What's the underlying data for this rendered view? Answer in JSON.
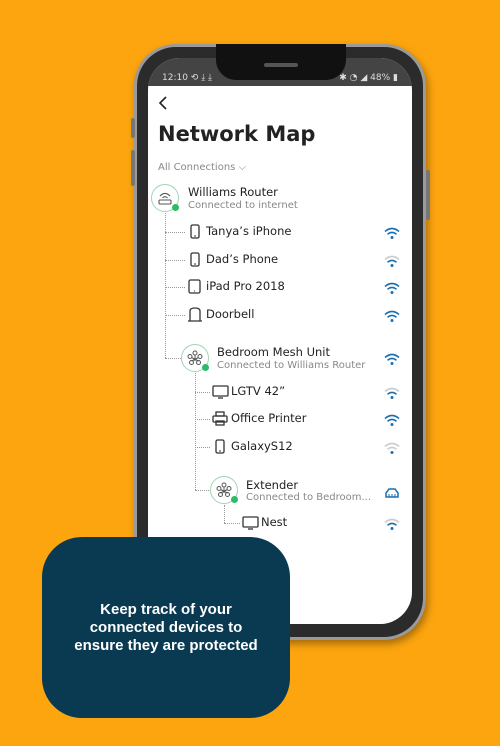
{
  "status_bar": {
    "time": "12:10  ⟲ ⤓ ⤓",
    "right": "✱ ◔ ◢ 48% ▮"
  },
  "header": {
    "back_icon": "chevron-left",
    "title": "Network Map",
    "filter": "All Connections ⌵"
  },
  "router": {
    "name": "Williams Router",
    "status": "Connected to internet",
    "icon": "router-icon"
  },
  "router_devices": [
    {
      "name": "Tanya’s iPhone",
      "icon": "phone",
      "signal": 3
    },
    {
      "name": "Dad’s Phone",
      "icon": "phone",
      "signal": 2
    },
    {
      "name": "iPad Pro 2018",
      "icon": "tablet",
      "signal": 3
    },
    {
      "name": "Doorbell",
      "icon": "doorbell",
      "signal": 3
    }
  ],
  "mesh": {
    "name": "Bedroom Mesh Unit",
    "status": "Connected to Williams Router",
    "signal": 3
  },
  "mesh_devices": [
    {
      "name": "LGTV 42”",
      "icon": "tv",
      "signal": 2
    },
    {
      "name": "Office Printer",
      "icon": "printer",
      "signal": 3
    },
    {
      "name": "GalaxyS12",
      "icon": "phone",
      "signal": 1
    }
  ],
  "extender": {
    "name": "Extender",
    "status": "Connected to Bedroom...",
    "connection": "ethernet"
  },
  "extender_devices": [
    {
      "name": "Nest",
      "icon": "tv",
      "signal": 2
    }
  ],
  "promo": {
    "text": "Keep track of your connected devices to ensure they are protected"
  },
  "colors": {
    "background": "#FDA50F",
    "card": "#093A52",
    "accent": "#1a6fb0",
    "online": "#2dbb6a"
  }
}
